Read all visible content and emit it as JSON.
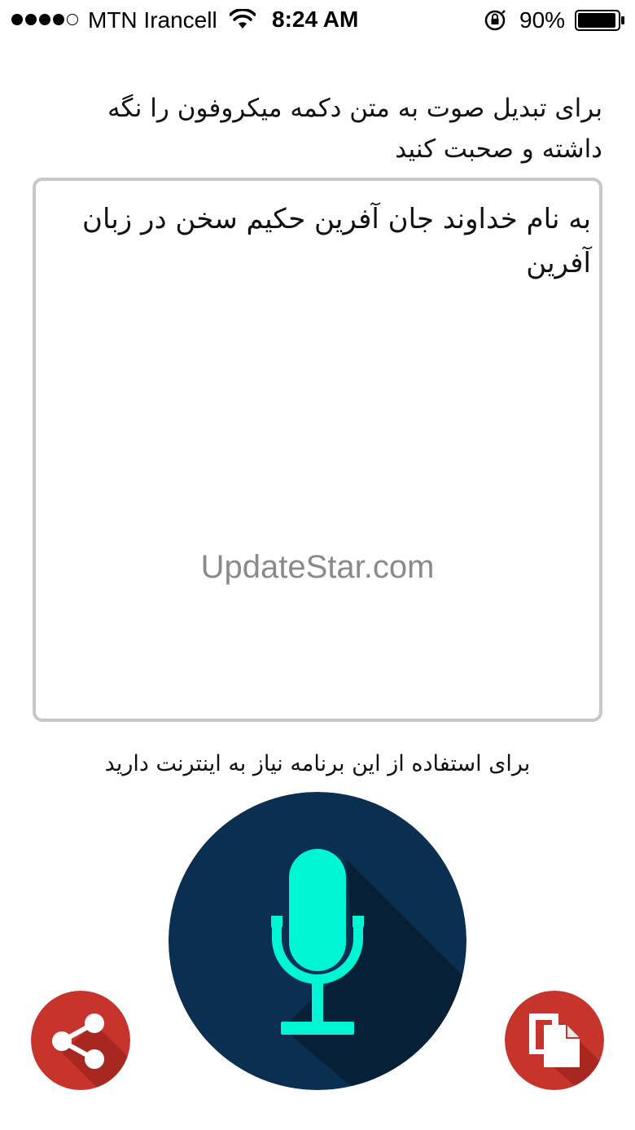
{
  "status_bar": {
    "carrier": "MTN Irancell",
    "time": "8:24 AM",
    "battery_percent": "90%",
    "signal_bars_filled": 4,
    "signal_bars_total": 5
  },
  "instruction": {
    "text": "برای تبدیل صوت به متن دکمه میکروفون را نگه داشته و صحبت کنید"
  },
  "transcript": {
    "text": "به نام خداوند جان آفرین حکیم سخن در زبان آفرین"
  },
  "watermark": {
    "text": "UpdateStar.com"
  },
  "note": {
    "text": "برای استفاده از این برنامه نیاز به اینترنت دارید"
  },
  "buttons": {
    "mic": {
      "icon": "microphone-icon"
    },
    "share": {
      "icon": "share-icon"
    },
    "copy": {
      "icon": "copy-icon"
    }
  },
  "colors": {
    "mic_bg": "#0a2f50",
    "mic_glyph": "#00f5d4",
    "action_bg": "#c6342c",
    "box_border": "#c8c8c8"
  }
}
